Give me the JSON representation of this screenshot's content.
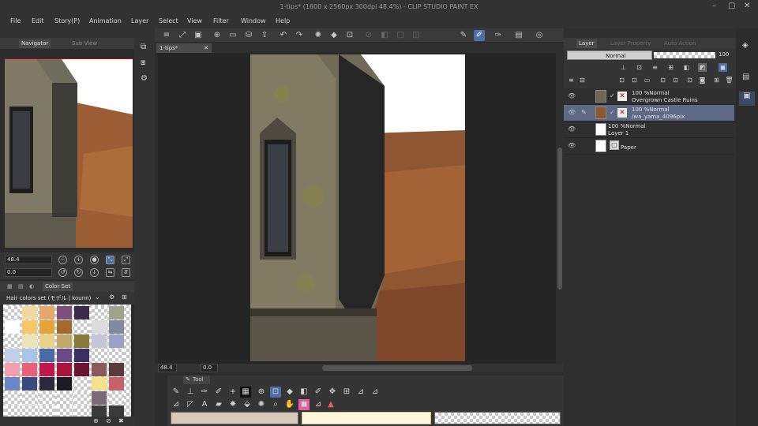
{
  "window": {
    "title": "1-tips* (1600 x 2560px 300dpi 48.4%) - CLIP STUDIO PAINT EX",
    "controls": {
      "minimize": "–",
      "maximize": "▢",
      "close": "✕"
    }
  },
  "menu": [
    "File",
    "Edit",
    "Story(P)",
    "Animation",
    "Layer",
    "Select",
    "View",
    "Filter",
    "Window",
    "Help"
  ],
  "navigator": {
    "tabs": [
      "Navigator",
      "Sub View"
    ],
    "zoom_value": "48.4",
    "angle_value": "0.0"
  },
  "color_set": {
    "tab": "Color Set",
    "set_name": "Hair colors set (モデル | kounn)",
    "swatches": [
      [
        "checker",
        "#f3d9a0",
        "#e3a86a",
        "#7e4f7a",
        "#3b2a4a",
        "checker",
        "#9fa38c"
      ],
      [
        "#ffffff",
        "#f6c86a",
        "#e8a23a",
        "#a06a2a",
        "checker",
        "#dcdcdc",
        "#7f8aa0"
      ],
      [
        "checker",
        "#efe3b8",
        "#e9d28a",
        "#c2a86a",
        "#8a7a3a",
        "#c5c7d6",
        "#9aa2c8"
      ],
      [
        "#c0d0e8",
        "#a8c4e8",
        "#4a6aa6",
        "#6a4a86",
        "#3a2e62",
        "checker",
        "checker"
      ],
      [
        "#f2a0b0",
        "#e8607a",
        "#c01848",
        "#a8163e",
        "#6a1430",
        "#8a5a5a",
        "#5a3a3a"
      ],
      [
        "#6a86c6",
        "#3a4a7a",
        "#2a2a3a",
        "#1a1a22",
        "checker",
        "#f6e08a",
        "#c8606a"
      ],
      [
        "checker",
        "checker",
        "checker",
        "checker",
        "checker",
        "#7a6a7a",
        "checker"
      ],
      [
        "checker",
        "checker",
        "checker",
        "checker",
        "checker",
        "#3a3a3a",
        "#3a3a3a"
      ]
    ]
  },
  "document": {
    "tab": "1-tips*",
    "zoom": "48.4",
    "angle": "0.0"
  },
  "tool_panel": {
    "tab": "Tool"
  },
  "layer_panel": {
    "tabs": [
      "Layer",
      "Layer Property",
      "Auto Action"
    ],
    "blend_mode": "Normal",
    "opacity": "100",
    "layers": [
      {
        "line1": "100 %Normal",
        "line2": "Overgrown Castle Ruins"
      },
      {
        "line1": "100 %Normal",
        "line2": "/wa_yama_4096pix"
      },
      {
        "line1": "100 %Normal",
        "line2": "Layer 1"
      },
      {
        "line1": "",
        "line2": "Paper"
      }
    ]
  },
  "colors": {
    "accent": "#4d6fa3",
    "selected_layer": "#5c6a86",
    "main_color": "#d8c8b8",
    "sub_color": "#fff8e0"
  }
}
